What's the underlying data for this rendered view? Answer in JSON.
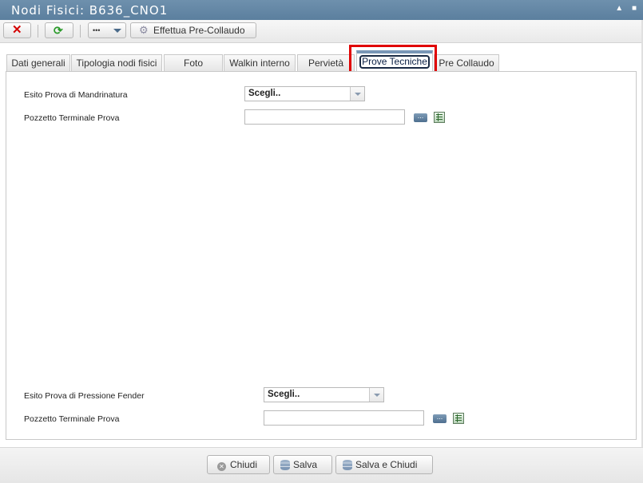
{
  "window": {
    "title": "Nodi Fisici: B636_CNO1"
  },
  "toolbar": {
    "more_label": "•••",
    "pre_collaudo_label": "Effettua Pre-Collaudo"
  },
  "tabs": [
    {
      "label": "Dati generali"
    },
    {
      "label": "Tipologia nodi fisici"
    },
    {
      "label": "Foto"
    },
    {
      "label": "Walkin interno"
    },
    {
      "label": "Pervietà"
    },
    {
      "label": "Prove Tecniche"
    },
    {
      "label": "Pre Collaudo"
    }
  ],
  "active_tab": "Prove Tecniche",
  "form": {
    "mandrinatura_label": "Esito Prova di Mandrinatura",
    "mandrinatura_value": "Scegli..",
    "pozzetto1_label": "Pozzetto Terminale Prova",
    "pozzetto1_value": "",
    "fender_label": "Esito Prova di Pressione Fender",
    "fender_value": "Scegli..",
    "pozzetto2_label": "Pozzetto Terminale Prova",
    "pozzetto2_value": "",
    "ellipsis": "..."
  },
  "footer": {
    "close_label": "Chiudi",
    "save_label": "Salva",
    "save_close_label": "Salva e Chiudi"
  },
  "colors": {
    "titlebar": "#5b7f9e",
    "highlight": "#e00000"
  }
}
